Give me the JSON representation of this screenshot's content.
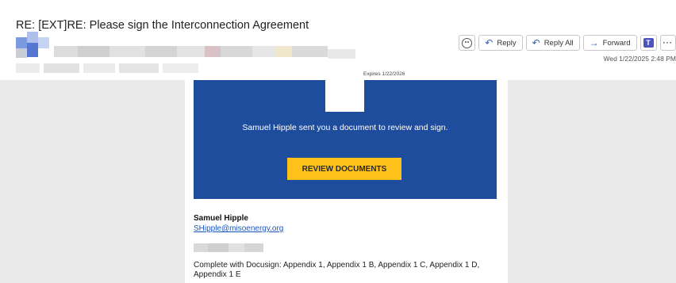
{
  "subject": "RE: [EXT]RE: Please sign the Interconnection Agreement",
  "toolbar": {
    "reply": "Reply",
    "reply_all": "Reply All",
    "forward": "Forward",
    "more": "···",
    "emoji_icon": "smiley-icon",
    "teams_icon": "teams-icon"
  },
  "date": "Wed 1/22/2025 2:48 PM",
  "expires": "Expires 1/22/2026",
  "banner": {
    "message": "Samuel Hipple sent you a document to review and sign.",
    "button": "REVIEW DOCUMENTS",
    "color": "#1f4d9e",
    "button_color": "#ffc21a"
  },
  "sender": {
    "name": "Samuel Hipple",
    "email": "SHipple@misoenergy.org"
  },
  "description": "Complete with Docusign: Appendix 1, Appendix 1 B, Appendix 1 C, Appendix 1 D, Appendix 1 E"
}
